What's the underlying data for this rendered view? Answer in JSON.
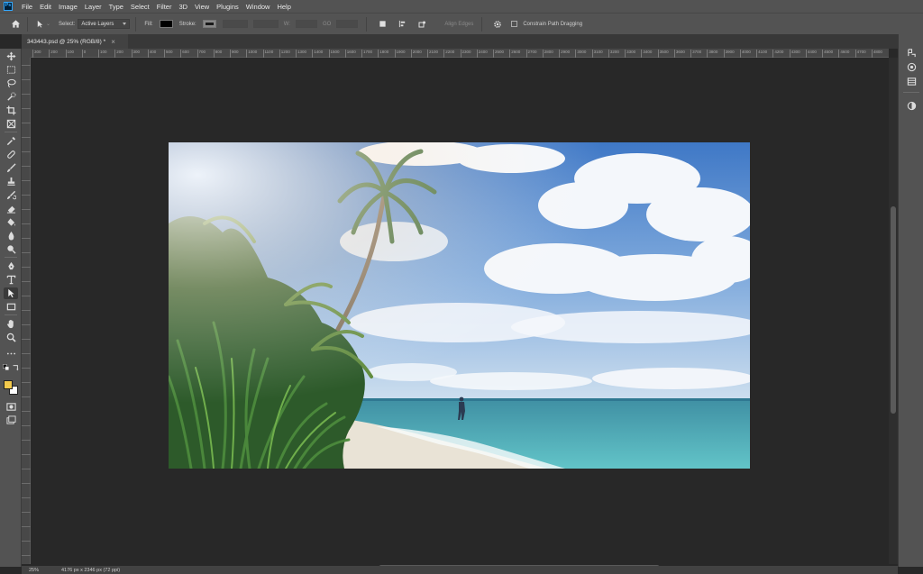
{
  "app": {
    "logo": "Ps"
  },
  "menu": [
    "File",
    "Edit",
    "Image",
    "Layer",
    "Type",
    "Select",
    "Filter",
    "3D",
    "View",
    "Plugins",
    "Window",
    "Help"
  ],
  "options": {
    "select_label": "Select:",
    "select_value": "Active Layers",
    "fill_label": "Fill:",
    "stroke_label": "Stroke:",
    "w_label": "W:",
    "h_label": "GO",
    "align_edges": "Align Edges",
    "constrain_label": "Constrain Path Dragging",
    "fill_color": "#000000",
    "stroke_color": "#1a1a1a"
  },
  "document": {
    "tab_title": "343443.psd @ 25% (RGB/8) *",
    "close_glyph": "×"
  },
  "ruler": {
    "marks": [
      "300",
      "200",
      "100",
      "0",
      "100",
      "200",
      "300",
      "400",
      "500",
      "600",
      "700",
      "800",
      "900",
      "1000",
      "1100",
      "1200",
      "1300",
      "1400",
      "1500",
      "1600",
      "1700",
      "1800",
      "1900",
      "2000",
      "2100",
      "2200",
      "2300",
      "2400",
      "2500",
      "2600",
      "2700",
      "2800",
      "2900",
      "3000",
      "3100",
      "3200",
      "3300",
      "3400",
      "3500",
      "3600",
      "3700",
      "3800",
      "3900",
      "4000",
      "4100",
      "4200",
      "4300",
      "4400",
      "4500",
      "4600",
      "4700",
      "4800"
    ]
  },
  "status": {
    "zoom": "25%",
    "info": "4176 px x 2346 px (72 ppi)"
  },
  "colors": {
    "foreground": "#f2c94c",
    "background": "#ffffff",
    "ui": "#535353",
    "canvas": "#282828"
  },
  "tools": [
    "move-tool",
    "marquee-tool",
    "lasso-tool",
    "quick-select-tool",
    "crop-tool",
    "frame-tool",
    "eyedropper-tool",
    "healing-tool",
    "brush-tool",
    "clone-stamp-tool",
    "history-brush-tool",
    "eraser-tool",
    "gradient-tool",
    "blur-tool",
    "dodge-tool",
    "pen-tool",
    "type-tool",
    "path-select-tool",
    "rectangle-tool",
    "hand-tool",
    "zoom-tool",
    "more-tools",
    "default-colors-icon",
    "quick-mask-tool",
    "screen-mode-tool",
    "artboard-tool"
  ]
}
